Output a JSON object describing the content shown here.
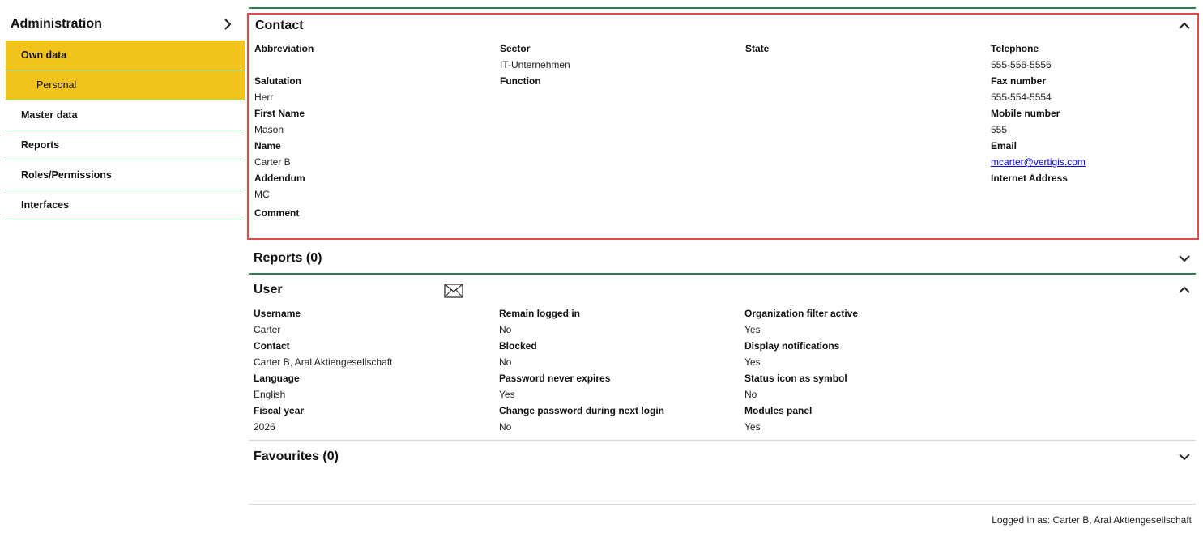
{
  "sidebar": {
    "title": "Administration",
    "items": [
      {
        "label": "Own data"
      },
      {
        "label": "Personal"
      },
      {
        "label": "Master data"
      },
      {
        "label": "Reports"
      },
      {
        "label": "Roles/Permissions"
      },
      {
        "label": "Interfaces"
      }
    ]
  },
  "contact": {
    "title": "Contact",
    "abbreviation": {
      "label": "Abbreviation",
      "value": ""
    },
    "salutation": {
      "label": "Salutation",
      "value": "Herr"
    },
    "first_name": {
      "label": "First Name",
      "value": "Mason"
    },
    "name": {
      "label": "Name",
      "value": "Carter B"
    },
    "addendum": {
      "label": "Addendum",
      "value": "MC"
    },
    "comment": {
      "label": "Comment",
      "value": ""
    },
    "sector": {
      "label": "Sector",
      "value": "IT-Unternehmen"
    },
    "function": {
      "label": "Function",
      "value": ""
    },
    "state": {
      "label": "State",
      "value": ""
    },
    "telephone": {
      "label": "Telephone",
      "value": "555-556-5556"
    },
    "fax": {
      "label": "Fax number",
      "value": "555-554-5554"
    },
    "mobile": {
      "label": "Mobile number",
      "value": "555"
    },
    "email": {
      "label": "Email",
      "value": "mcarter@vertigis.com"
    },
    "internet": {
      "label": "Internet Address",
      "value": ""
    }
  },
  "reports": {
    "title": "Reports (0)"
  },
  "user": {
    "title": "User",
    "username": {
      "label": "Username",
      "value": "Carter"
    },
    "contact": {
      "label": "Contact",
      "value": "Carter B, Aral Aktiengesellschaft"
    },
    "language": {
      "label": "Language",
      "value": "English"
    },
    "fiscal_year": {
      "label": "Fiscal year",
      "value": "2026"
    },
    "remain_logged_in": {
      "label": "Remain logged in",
      "value": "No"
    },
    "blocked": {
      "label": "Blocked",
      "value": "No"
    },
    "password_never_expires": {
      "label": "Password never expires",
      "value": "Yes"
    },
    "change_password": {
      "label": "Change password during next login",
      "value": "No"
    },
    "org_filter": {
      "label": "Organization filter active",
      "value": "Yes"
    },
    "display_notifications": {
      "label": "Display notifications",
      "value": "Yes"
    },
    "status_icon": {
      "label": "Status icon as symbol",
      "value": "No"
    },
    "modules_panel": {
      "label": "Modules panel",
      "value": "Yes"
    }
  },
  "favourites": {
    "title": "Favourites (0)"
  },
  "footer": {
    "logged_in": "Logged in as: Carter B, Aral Aktiengesellschaft"
  },
  "colors": {
    "accent_green": "#2e7d4a",
    "active_yellow": "#f2c318",
    "highlight_red": "#e24a4a"
  },
  "icons": [
    "chevron-right-icon",
    "chevron-up-icon",
    "chevron-down-icon",
    "mail-icon"
  ]
}
